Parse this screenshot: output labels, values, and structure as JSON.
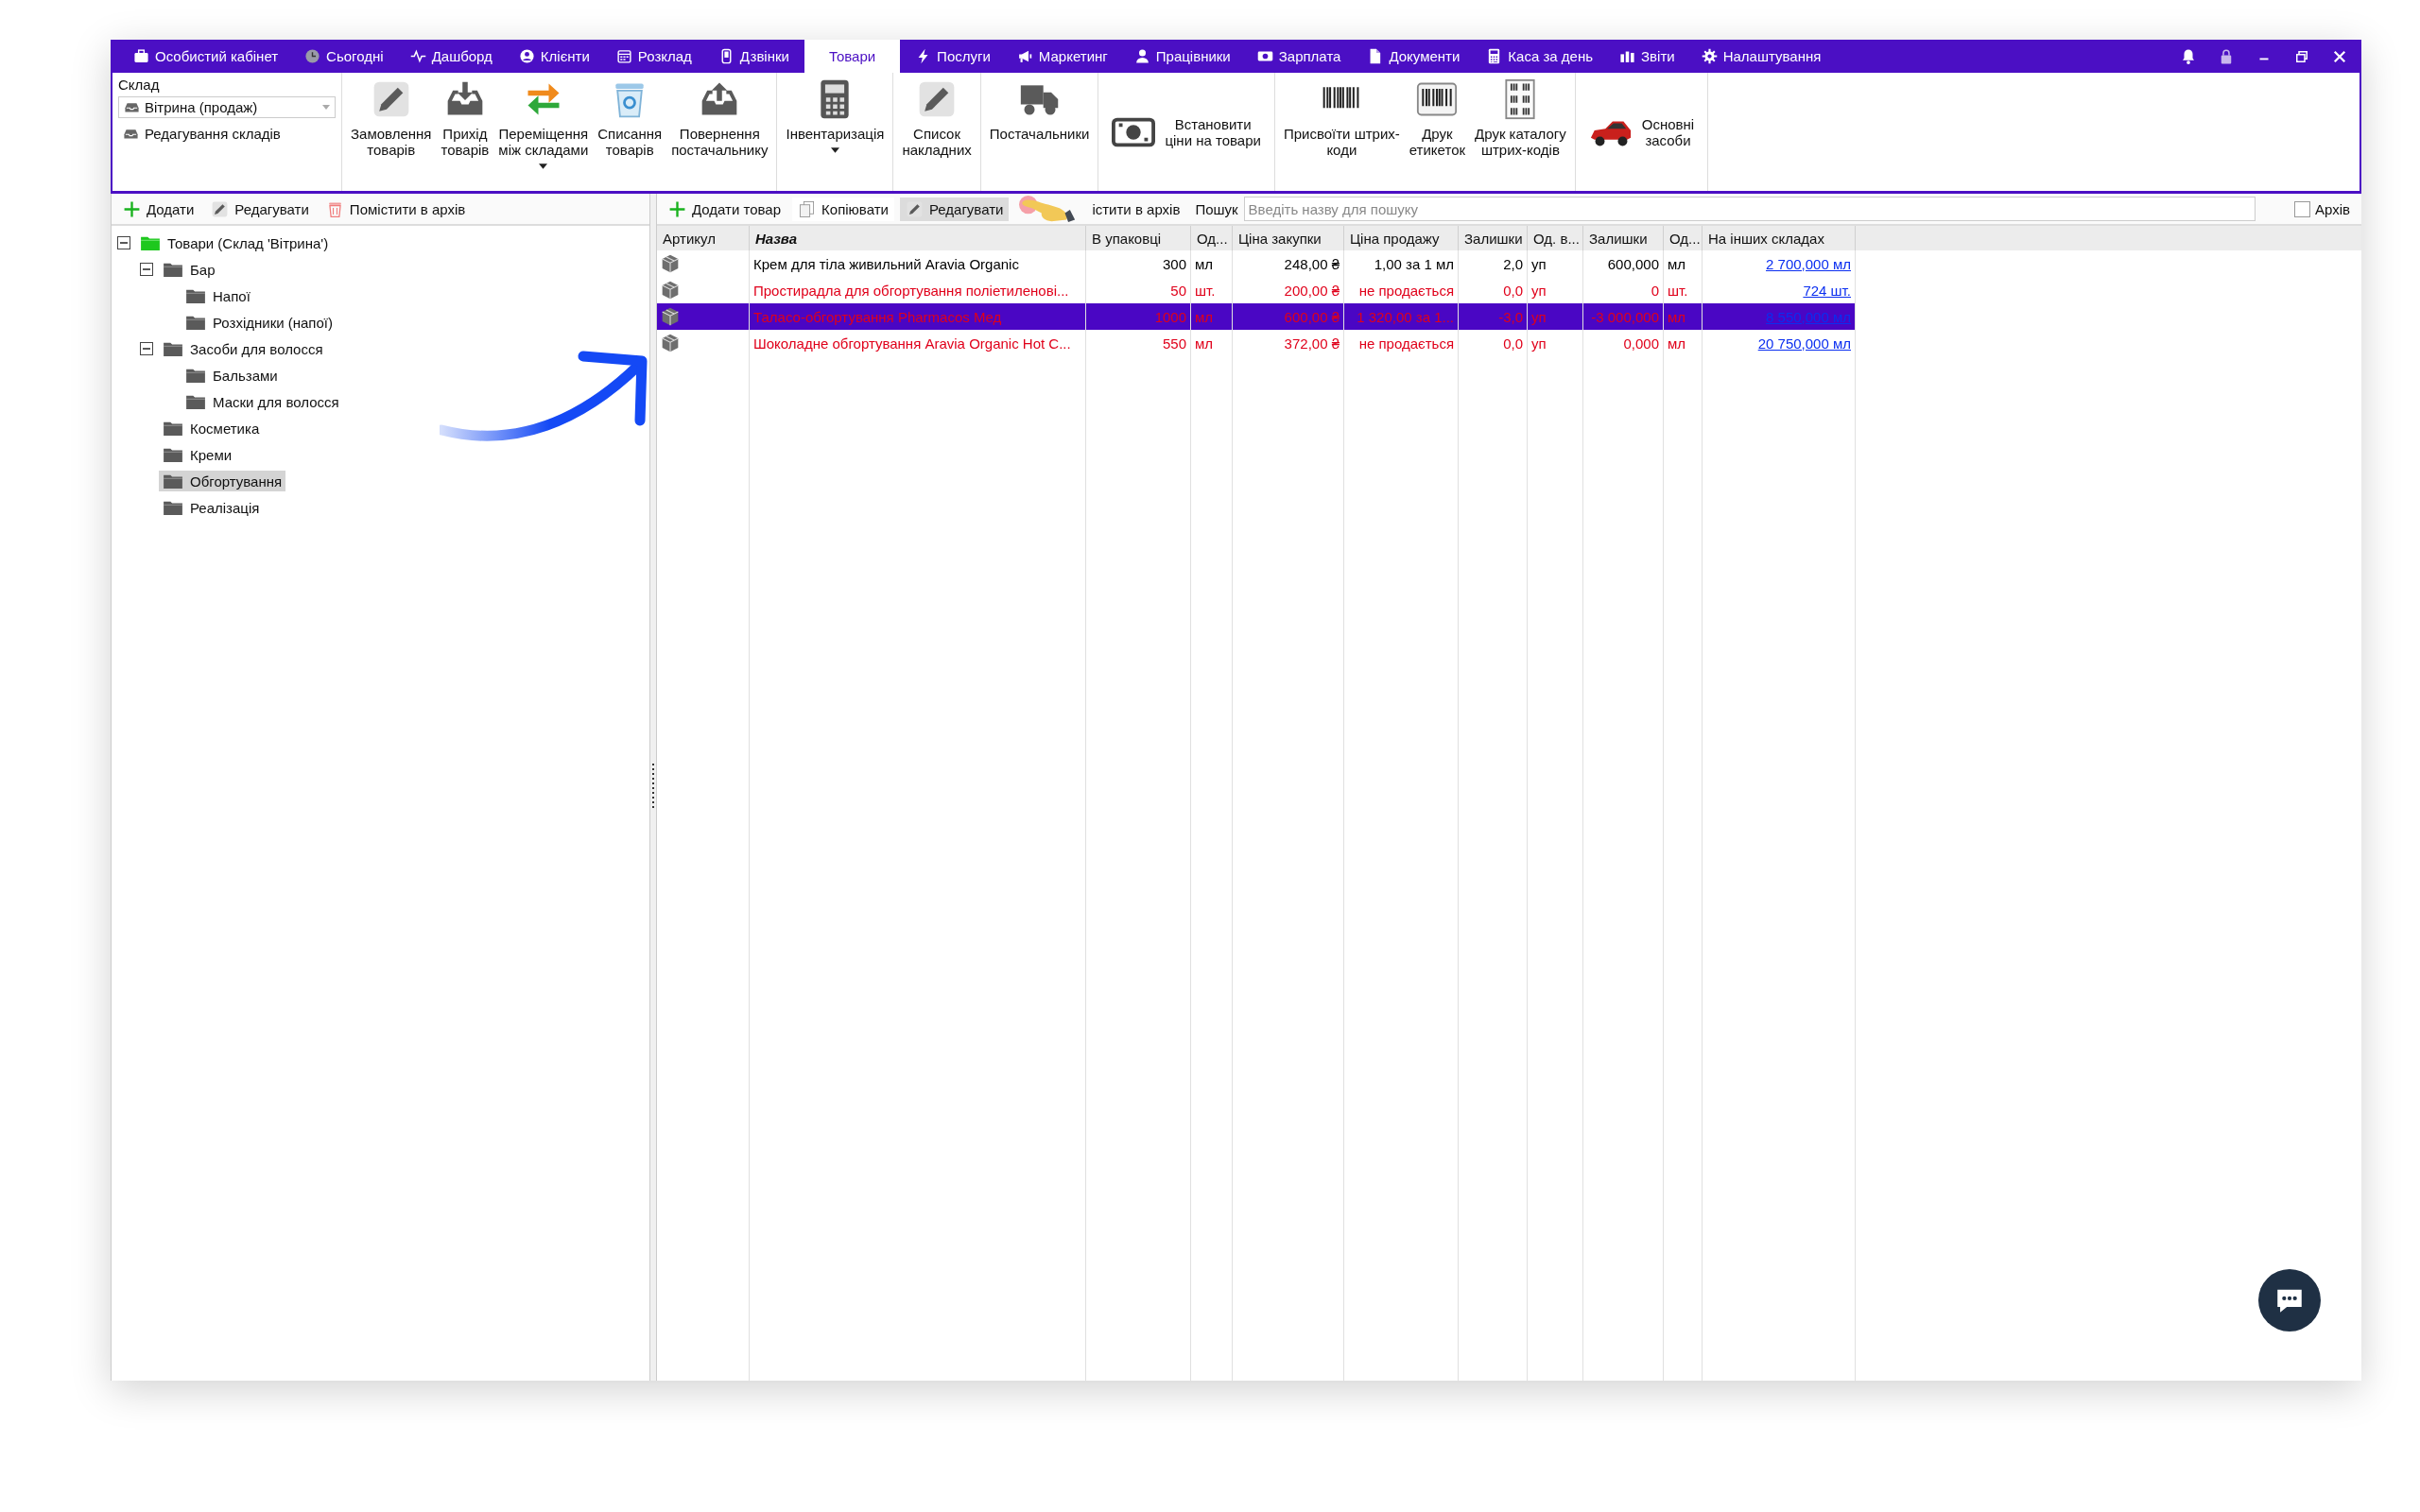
{
  "tabs": [
    {
      "label": "Особистий кабінет",
      "selected": false
    },
    {
      "label": "Сьогодні",
      "selected": false
    },
    {
      "label": "Дашборд",
      "selected": false
    },
    {
      "label": "Клієнти",
      "selected": false
    },
    {
      "label": "Розклад",
      "selected": false
    },
    {
      "label": "Дзвінки",
      "selected": false
    },
    {
      "label": "Товари",
      "selected": true
    },
    {
      "label": "Послуги",
      "selected": false
    },
    {
      "label": "Маркетинг",
      "selected": false
    },
    {
      "label": "Працівники",
      "selected": false
    },
    {
      "label": "Зарплата",
      "selected": false
    },
    {
      "label": "Документи",
      "selected": false
    },
    {
      "label": "Каса за день",
      "selected": false
    },
    {
      "label": "Звіти",
      "selected": false
    },
    {
      "label": "Налаштування",
      "selected": false
    }
  ],
  "ribbon": {
    "warehouse_label": "Склад",
    "warehouse_select": "Вітрина (продаж)",
    "edit_warehouses": "Редагування складів",
    "groups": [
      [
        {
          "label": "Замовлення\nтоварів",
          "kind": "tall",
          "dropdown": false
        },
        {
          "label": "Прихід\nтоварів",
          "kind": "tall",
          "dropdown": false
        },
        {
          "label": "Переміщення\nміж складами",
          "kind": "tall",
          "dropdown": true
        },
        {
          "label": "Списання\nтоварів",
          "kind": "tall",
          "dropdown": false
        },
        {
          "label": "Повернення\nпостачальнику",
          "kind": "tall",
          "dropdown": false
        }
      ],
      [
        {
          "label": "Інвентаризація",
          "kind": "tall",
          "dropdown": true
        }
      ],
      [
        {
          "label": "Список\nнакладних",
          "kind": "tall",
          "dropdown": false
        }
      ],
      [
        {
          "label": "Постачальники",
          "kind": "tall",
          "dropdown": false
        }
      ],
      [
        {
          "label": "Встановити\nціни на товари",
          "kind": "wide",
          "dropdown": false
        }
      ],
      [
        {
          "label": "Присвоїти штрих-\nкоди",
          "kind": "tall",
          "dropdown": false
        },
        {
          "label": "Друк\nетикеток",
          "kind": "tall",
          "dropdown": false
        },
        {
          "label": "Друк каталогу\nштрих-кодів",
          "kind": "tall",
          "dropdown": false
        }
      ],
      [
        {
          "label": "Основні\nзасоби",
          "kind": "wide",
          "dropdown": false
        }
      ]
    ]
  },
  "left_toolbar": [
    "Додати",
    "Редагувати",
    "Помістити в архів"
  ],
  "tree": {
    "items": [
      {
        "label": "Товари (Склад 'Вітрина')",
        "expanded": true,
        "selected": false,
        "children": [
          {
            "label": "Бар",
            "expanded": true,
            "selected": false,
            "children": [
              {
                "label": "Напої",
                "selected": false
              },
              {
                "label": "Розхідники (напої)",
                "selected": false
              }
            ]
          },
          {
            "label": "Засоби для волосся",
            "expanded": true,
            "selected": false,
            "children": [
              {
                "label": "Бальзами",
                "selected": false
              },
              {
                "label": "Маски для волосся",
                "selected": false
              }
            ]
          },
          {
            "label": "Косметика",
            "selected": false
          },
          {
            "label": "Креми",
            "selected": false
          },
          {
            "label": "Обгортування",
            "selected": true
          },
          {
            "label": "Реалізація",
            "selected": false
          }
        ]
      }
    ]
  },
  "right_toolbar": {
    "buttons": [
      "Додати товар",
      "Копіювати",
      "Редагувати",
      "істити в архів"
    ],
    "search_label": "Пошук",
    "search": {
      "placeholder": "Введіть назву для пошуку"
    },
    "archive": {
      "label": "Архів",
      "checked": false
    }
  },
  "table": {
    "columns": [
      {
        "label": "Артикул",
        "kind": "icon",
        "sorted": false
      },
      {
        "label": "Назва",
        "kind": "text",
        "sorted": true
      },
      {
        "label": "В упаковці",
        "kind": "number",
        "sorted": false
      },
      {
        "label": "Од...",
        "kind": "text",
        "sorted": false
      },
      {
        "label": "Ціна закупки",
        "kind": "number",
        "sorted": false
      },
      {
        "label": "Ціна продажу",
        "kind": "number",
        "sorted": false
      },
      {
        "label": "Залишки",
        "kind": "number",
        "sorted": false
      },
      {
        "label": "Од. в...",
        "kind": "text",
        "sorted": false
      },
      {
        "label": "Залишки",
        "kind": "number",
        "sorted": false
      },
      {
        "label": "Од...",
        "kind": "text",
        "sorted": false
      },
      {
        "label": "На інших складах",
        "kind": "link",
        "sorted": false
      }
    ],
    "rows": [
      {
        "selected": false,
        "color": "#000000",
        "cells": [
          "",
          "Крем для тіла живильний Aravia Organic",
          "300",
          "мл",
          "248,00 ₴",
          "1,00 за 1 мл",
          "2,0",
          "уп",
          "600,000",
          "мл",
          "2 700,000 мл"
        ]
      },
      {
        "selected": false,
        "color": "#e0001a",
        "cells": [
          "",
          "Простирадла для обгортування поліетиленові...",
          "50",
          "шт.",
          "200,00 ₴",
          "не продається",
          "0,0",
          "уп",
          "0",
          "шт.",
          "724 шт."
        ]
      },
      {
        "selected": true,
        "color": "#e0001a",
        "cells": [
          "",
          "Таласо-обгортування Pharmacos Мед",
          "1000",
          "мл",
          "600,00 ₴",
          "1 320,00 за 1...",
          "-3,0",
          "уп",
          "-3 000,000",
          "мл",
          "8 550,000 мл"
        ]
      },
      {
        "selected": false,
        "color": "#e0001a",
        "cells": [
          "",
          "Шоколадне обгортування Aravia Organic Hot C...",
          "550",
          "мл",
          "372,00 ₴",
          "не продається",
          "0,0",
          "уп",
          "0,000",
          "мл",
          "20 750,000 мл"
        ]
      }
    ]
  }
}
